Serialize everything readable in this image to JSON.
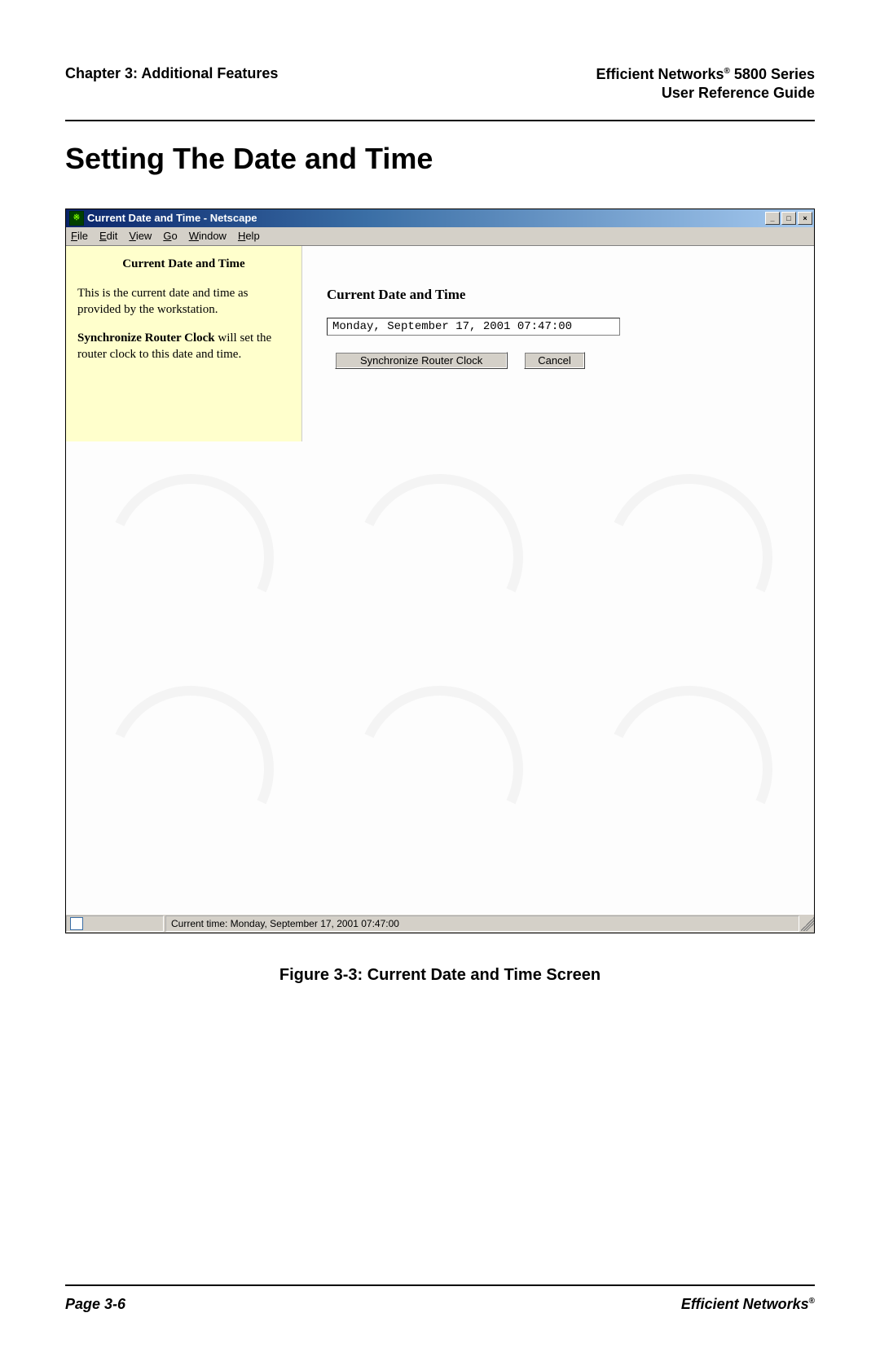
{
  "header": {
    "chapter": "Chapter 3: Additional Features",
    "product": "Efficient Networks",
    "series": " 5800 Series",
    "guide": "User Reference Guide"
  },
  "section_title": "Setting The Date and Time",
  "window": {
    "title": "Current Date and Time - Netscape",
    "menus": {
      "file": "File",
      "edit": "Edit",
      "view": "View",
      "go": "Go",
      "window": "Window",
      "help": "Help"
    },
    "sidebar": {
      "title": "Current Date and Time",
      "para1": "This is the current date and time as provided by the workstation.",
      "para2_bold": "Synchronize Router Clock",
      "para2_rest": " will set the router clock to this date and time."
    },
    "main": {
      "title": "Current Date and Time",
      "datetime_value": "Monday, September 17, 2001 07:47:00",
      "sync_button": "Synchronize Router Clock",
      "cancel_button": "Cancel"
    },
    "statusbar": {
      "text": "Current time: Monday, September 17, 2001 07:47:00"
    }
  },
  "figure_caption": "Figure 3-3:  Current Date and Time Screen",
  "footer": {
    "page": "Page 3-6",
    "brand": "Efficient Networks"
  }
}
